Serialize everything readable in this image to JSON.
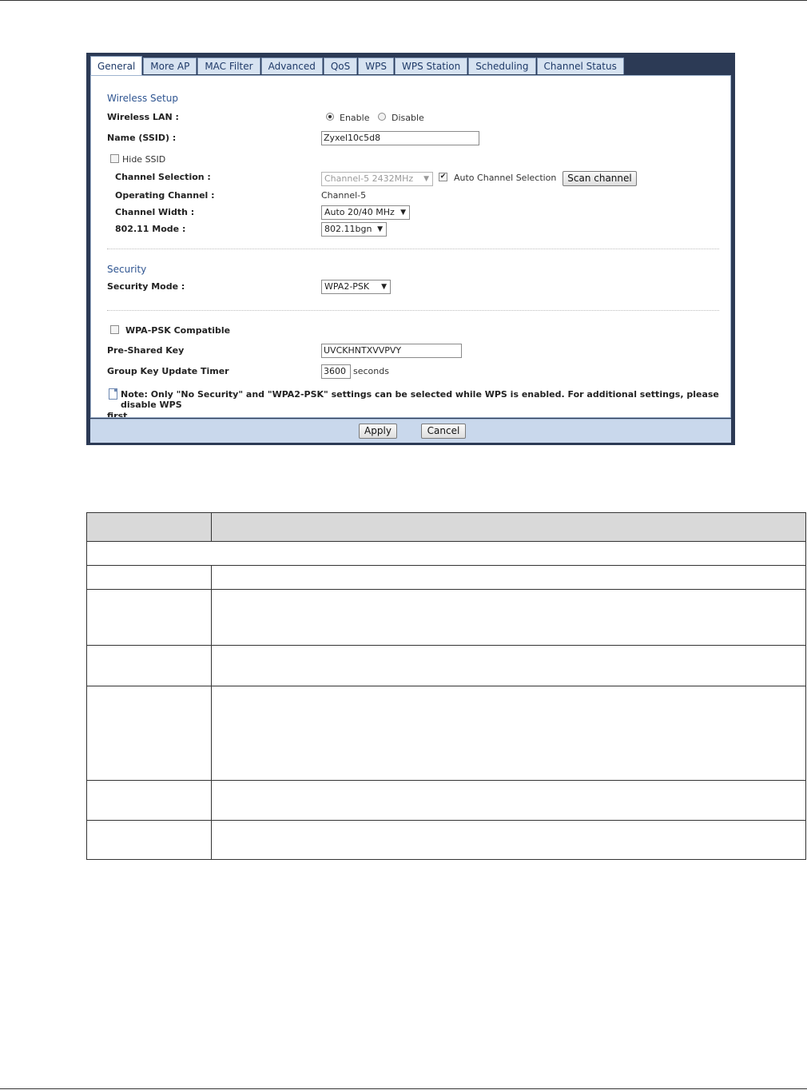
{
  "tabs": [
    "General",
    "More AP",
    "MAC Filter",
    "Advanced",
    "QoS",
    "WPS",
    "WPS Station",
    "Scheduling",
    "Channel Status"
  ],
  "wireless_setup": {
    "title": "Wireless Setup",
    "wireless_lan_label": "Wireless LAN :",
    "enable_label": "Enable",
    "disable_label": "Disable",
    "wireless_lan_value": "Enable",
    "ssid_label": "Name (SSID) :",
    "ssid_value": "Zyxel10c5d8",
    "hide_ssid_label": "Hide SSID",
    "hide_ssid_checked": false,
    "channel_selection_label": "Channel Selection :",
    "channel_selection_value": "Channel-5 2432MHz",
    "auto_channel_label": "Auto Channel Selection",
    "auto_channel_checked": true,
    "scan_channel_label": "Scan channel",
    "operating_channel_label": "Operating Channel :",
    "operating_channel_value": "Channel-5",
    "channel_width_label": "Channel Width :",
    "channel_width_value": "Auto 20/40 MHz",
    "mode_label": "802.11 Mode :",
    "mode_value": "802.11bgn"
  },
  "security": {
    "title": "Security",
    "mode_label": "Security Mode :",
    "mode_value": "WPA2-PSK",
    "wpa_psk_compatible_label": "WPA-PSK Compatible",
    "wpa_psk_compatible_checked": false,
    "psk_label": "Pre-Shared Key",
    "psk_value": "UVCKHNTXVVPVY",
    "group_key_label": "Group Key Update Timer",
    "group_key_value": "3600",
    "group_key_unit": "seconds"
  },
  "note": {
    "line1": "Note: Only \"No Security\" and \"WPA2-PSK\" settings can be selected while WPS is enabled. For additional settings, please disable WPS",
    "line2": "first."
  },
  "footer": {
    "apply_label": "Apply",
    "cancel_label": "Cancel"
  }
}
